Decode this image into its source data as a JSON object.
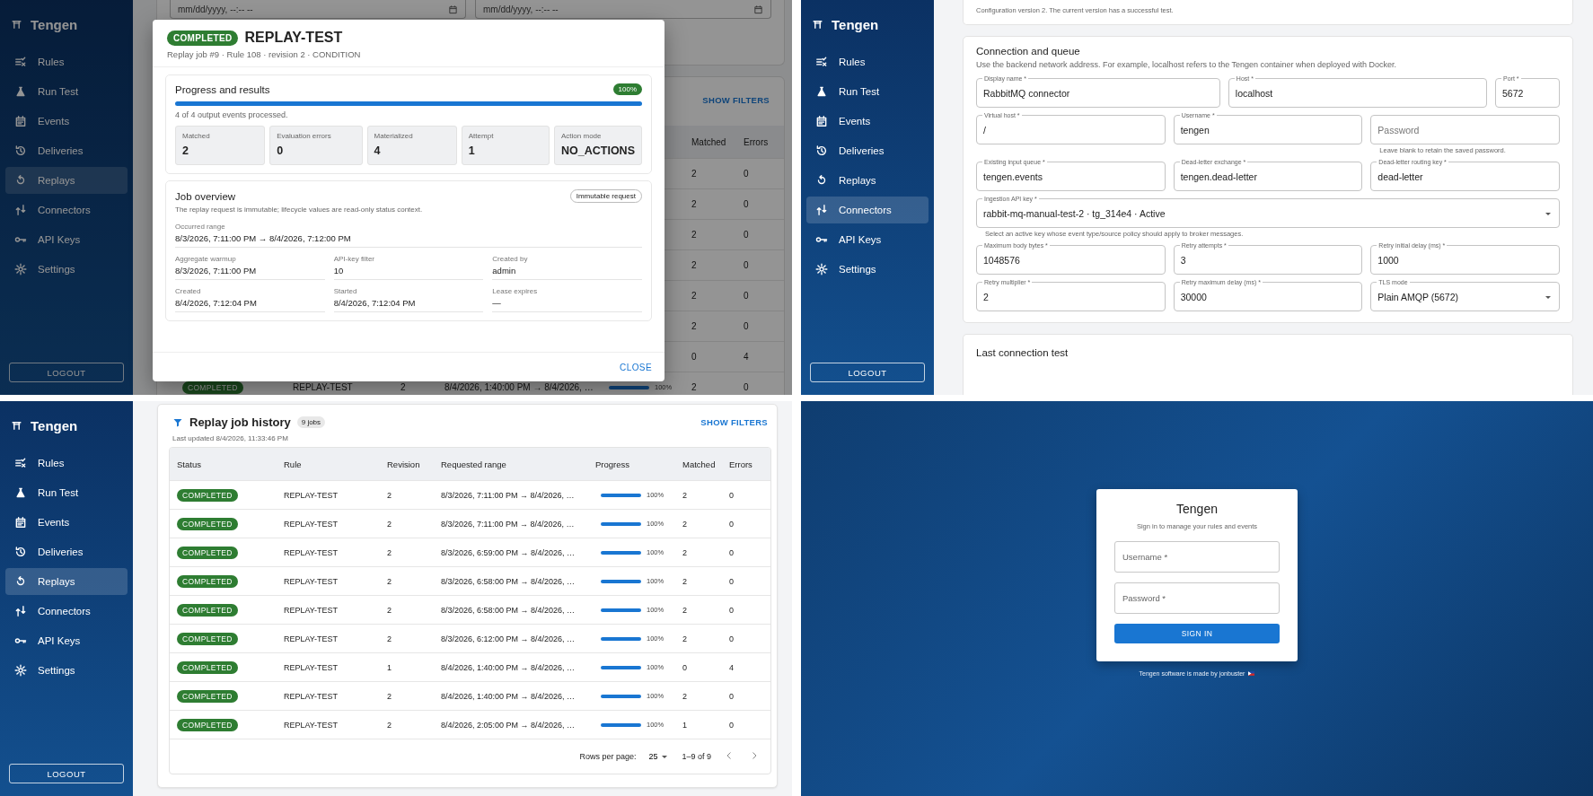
{
  "screens": [
    {
      "kind": "replay_detail",
      "sidebar": {
        "brand": "Tengen",
        "logout": "LOGOUT",
        "items": [
          {
            "label": "Rules",
            "selected": false
          },
          {
            "label": "Run Test",
            "selected": false
          },
          {
            "label": "Events",
            "selected": false
          },
          {
            "label": "Deliveries",
            "selected": false
          },
          {
            "label": "Replays",
            "selected": true
          },
          {
            "label": "Connectors",
            "selected": false
          },
          {
            "label": "API Keys",
            "selected": false
          },
          {
            "label": "Settings",
            "selected": false
          }
        ]
      },
      "background": {
        "date_fields": [
          "mm/dd/yyyy, --:-- --",
          "mm/dd/yyyy, --:-- --"
        ],
        "show_filters": "SHOW FILTERS",
        "columns": [
          "Matched",
          "Errors"
        ],
        "rows": [
          {
            "matched": "2",
            "errors": "0"
          },
          {
            "matched": "2",
            "errors": "0"
          },
          {
            "matched": "2",
            "errors": "0"
          },
          {
            "matched": "2",
            "errors": "0"
          },
          {
            "matched": "2",
            "errors": "0"
          },
          {
            "matched": "2",
            "errors": "0"
          },
          {
            "matched": "0",
            "errors": "4"
          }
        ],
        "last_row": {
          "status": "COMPLETED",
          "rule": "REPLAY-TEST",
          "revision": "2",
          "range": "8/4/2026, 1:40:00 PM → 8/4/2026, …",
          "level": 1,
          "progress": "100%",
          "matched": "2",
          "errors": "0"
        }
      },
      "dialog": {
        "status": "COMPLETED",
        "title": "REPLAY-TEST",
        "subtitle": "Replay job #9 · Rule 108 · revision 2 · CONDITION",
        "progress": {
          "title": "Progress and results",
          "percent": "100%",
          "level": 1,
          "summary": "4 of 4 output events processed.",
          "stats": [
            {
              "label": "Matched",
              "value": "2"
            },
            {
              "label": "Evaluation errors",
              "value": "0"
            },
            {
              "label": "Materialized",
              "value": "4"
            },
            {
              "label": "Attempt",
              "value": "1"
            },
            {
              "label": "Action mode",
              "value": "NO_ACTIONS"
            }
          ]
        },
        "overview": {
          "title": "Job overview",
          "chip": "Immutable request",
          "description": "The replay request is immutable; lifecycle values are read-only status context.",
          "range_label": "Occurred range",
          "range_value": "8/3/2026, 7:11:00 PM → 8/4/2026, 7:12:00 PM",
          "details": [
            {
              "label": "Aggregate warmup",
              "value": "8/3/2026, 7:11:00 PM"
            },
            {
              "label": "API-key filter",
              "value": "10"
            },
            {
              "label": "Created by",
              "value": "admin"
            },
            {
              "label": "Created",
              "value": "8/4/2026, 7:12:04 PM"
            },
            {
              "label": "Started",
              "value": "8/4/2026, 7:12:04 PM"
            },
            {
              "label": "Lease expires",
              "value": "—"
            }
          ]
        },
        "close": "CLOSE"
      }
    },
    {
      "kind": "connector",
      "sidebar": {
        "brand": "Tengen",
        "logout": "LOGOUT",
        "items": [
          {
            "label": "Rules",
            "selected": false
          },
          {
            "label": "Run Test",
            "selected": false
          },
          {
            "label": "Events",
            "selected": false
          },
          {
            "label": "Deliveries",
            "selected": false
          },
          {
            "label": "Replays",
            "selected": false
          },
          {
            "label": "Connectors",
            "selected": true
          },
          {
            "label": "API Keys",
            "selected": false
          },
          {
            "label": "Settings",
            "selected": false
          }
        ]
      },
      "config_note": "Configuration version 2. The current version has a successful test.",
      "connection": {
        "title": "Connection and queue",
        "description": "Use the backend network address. For example, localhost refers to the Tengen container when deployed with Docker.",
        "rows": [
          {
            "fields": [
              {
                "kind": "text",
                "label": "Display name *",
                "value": "RabbitMQ connector"
              },
              {
                "kind": "text",
                "label": "Host *",
                "value": "localhost"
              },
              {
                "kind": "text",
                "label": "Port *",
                "value": "5672"
              }
            ]
          },
          {
            "fields": [
              {
                "kind": "text",
                "label": "Virtual host *",
                "value": "/"
              },
              {
                "kind": "text",
                "label": "Username *",
                "value": "tengen"
              },
              {
                "kind": "password",
                "placeholder": "Password",
                "helper": "Leave blank to retain the saved password."
              }
            ]
          },
          {
            "fields": [
              {
                "kind": "text",
                "label": "Existing input queue *",
                "value": "tengen.events"
              },
              {
                "kind": "text",
                "label": "Dead-letter exchange *",
                "value": "tengen.dead-letter"
              },
              {
                "kind": "text",
                "label": "Dead-letter routing key *",
                "value": "dead-letter"
              }
            ]
          },
          {
            "fields": [
              {
                "kind": "select",
                "label": "Ingestion API key *",
                "value": "rabbit-mq-manual-test-2 · tg_314e4 · Active",
                "helper": "Select an active key whose event type/source policy should apply to broker messages."
              }
            ]
          },
          {
            "fields": [
              {
                "kind": "text",
                "label": "Maximum body bytes *",
                "value": "1048576"
              },
              {
                "kind": "text",
                "label": "Retry attempts *",
                "value": "3"
              },
              {
                "kind": "text",
                "label": "Retry initial delay (ms) *",
                "value": "1000"
              }
            ]
          },
          {
            "fields": [
              {
                "kind": "text",
                "label": "Retry multiplier *",
                "value": "2"
              },
              {
                "kind": "text",
                "label": "Retry maximum delay (ms) *",
                "value": "30000"
              },
              {
                "kind": "select",
                "label": "TLS mode",
                "value": "Plain AMQP (5672)"
              }
            ]
          }
        ]
      },
      "last_test": {
        "title": "Last connection test"
      }
    },
    {
      "kind": "replay_list",
      "sidebar": {
        "brand": "Tengen",
        "logout": "LOGOUT",
        "items": [
          {
            "label": "Rules",
            "selected": false
          },
          {
            "label": "Run Test",
            "selected": false
          },
          {
            "label": "Events",
            "selected": false
          },
          {
            "label": "Deliveries",
            "selected": false
          },
          {
            "label": "Replays",
            "selected": true
          },
          {
            "label": "Connectors",
            "selected": false
          },
          {
            "label": "API Keys",
            "selected": false
          },
          {
            "label": "Settings",
            "selected": false
          }
        ]
      },
      "history": {
        "title": "Replay job history",
        "count": "9 jobs",
        "show_filters": "SHOW FILTERS",
        "updated": "Last updated 8/4/2026, 11:33:46 PM",
        "columns": [
          "Status",
          "Rule",
          "Revision",
          "Requested range",
          "Progress",
          "Matched",
          "Errors"
        ],
        "rows": [
          {
            "status": "COMPLETED",
            "rule": "REPLAY-TEST",
            "revision": "2",
            "range": "8/3/2026, 7:11:00 PM → 8/4/2026, …",
            "level": 1,
            "progress": "100%",
            "matched": "2",
            "errors": "0"
          },
          {
            "status": "COMPLETED",
            "rule": "REPLAY-TEST",
            "revision": "2",
            "range": "8/3/2026, 7:11:00 PM → 8/4/2026, …",
            "level": 1,
            "progress": "100%",
            "matched": "2",
            "errors": "0"
          },
          {
            "status": "COMPLETED",
            "rule": "REPLAY-TEST",
            "revision": "2",
            "range": "8/3/2026, 6:59:00 PM → 8/4/2026, …",
            "level": 1,
            "progress": "100%",
            "matched": "2",
            "errors": "0"
          },
          {
            "status": "COMPLETED",
            "rule": "REPLAY-TEST",
            "revision": "2",
            "range": "8/3/2026, 6:58:00 PM → 8/4/2026, …",
            "level": 1,
            "progress": "100%",
            "matched": "2",
            "errors": "0"
          },
          {
            "status": "COMPLETED",
            "rule": "REPLAY-TEST",
            "revision": "2",
            "range": "8/3/2026, 6:58:00 PM → 8/4/2026, …",
            "level": 1,
            "progress": "100%",
            "matched": "2",
            "errors": "0"
          },
          {
            "status": "COMPLETED",
            "rule": "REPLAY-TEST",
            "revision": "2",
            "range": "8/3/2026, 6:12:00 PM → 8/4/2026, …",
            "level": 1,
            "progress": "100%",
            "matched": "2",
            "errors": "0"
          },
          {
            "status": "COMPLETED",
            "rule": "REPLAY-TEST",
            "revision": "1",
            "range": "8/4/2026, 1:40:00 PM → 8/4/2026, …",
            "level": 1,
            "progress": "100%",
            "matched": "0",
            "errors": "4"
          },
          {
            "status": "COMPLETED",
            "rule": "REPLAY-TEST",
            "revision": "2",
            "range": "8/4/2026, 1:40:00 PM → 8/4/2026, …",
            "level": 1,
            "progress": "100%",
            "matched": "2",
            "errors": "0"
          },
          {
            "status": "COMPLETED",
            "rule": "REPLAY-TEST",
            "revision": "2",
            "range": "8/4/2026, 2:05:00 PM → 8/4/2026, …",
            "level": 1,
            "progress": "100%",
            "matched": "1",
            "errors": "0"
          }
        ],
        "pagination": {
          "rows_label": "Rows per page:",
          "rows_value": "25",
          "range": "1–9 of 9"
        }
      }
    },
    {
      "kind": "login",
      "title": "Tengen",
      "subtitle": "Sign in to manage your rules and events",
      "fields": [
        {
          "placeholder": "Username *"
        },
        {
          "placeholder": "Password *"
        }
      ],
      "button": "SIGN IN",
      "footer": "Tengen software is made by jonbuster"
    }
  ]
}
